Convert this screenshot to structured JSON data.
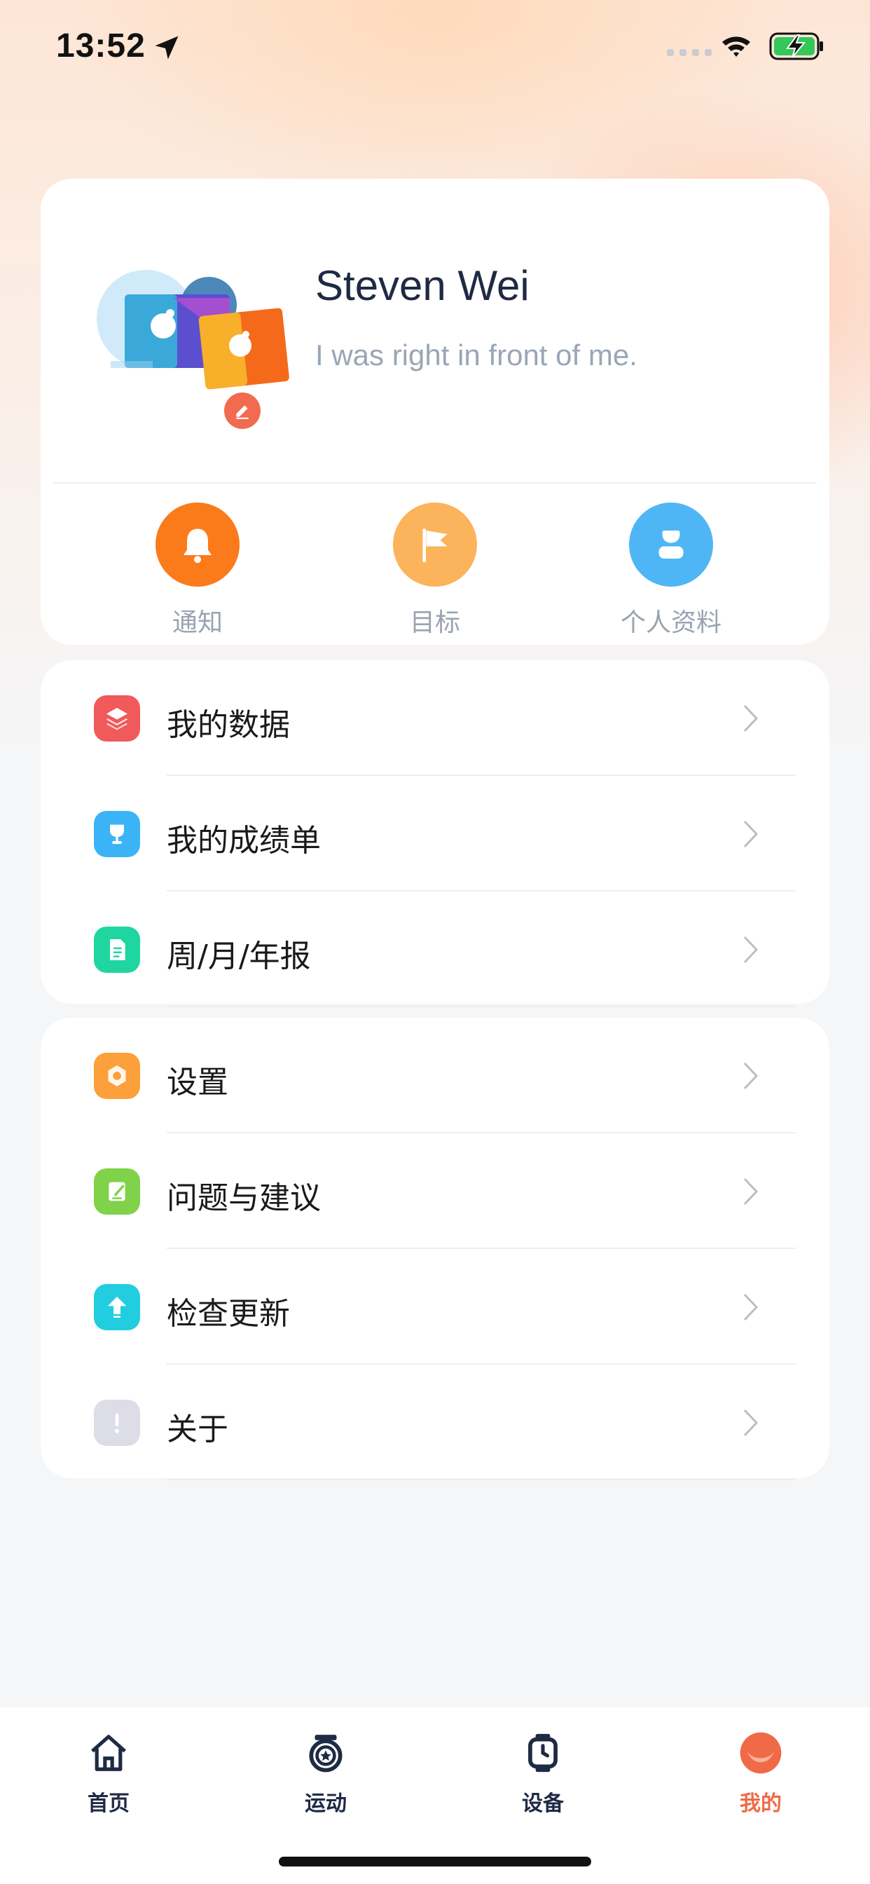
{
  "status_bar": {
    "time": "13:52"
  },
  "profile": {
    "name": "Steven Wei",
    "bio": "I was right in front of me."
  },
  "quick_actions": [
    {
      "label": "通知",
      "icon": "bell-icon",
      "color": "#fb7a1a"
    },
    {
      "label": "目标",
      "icon": "flag-icon",
      "color": "#fbb45c"
    },
    {
      "label": "个人资料",
      "icon": "user-icon",
      "color": "#4fb6f5"
    }
  ],
  "menu_group_1": [
    {
      "label": "我的数据",
      "icon": "layers-icon",
      "color": "#f05a5a"
    },
    {
      "label": "我的成绩单",
      "icon": "trophy-icon",
      "color": "#3ab4f7"
    },
    {
      "label": "周/月/年报",
      "icon": "document-icon",
      "color": "#20d6a0"
    }
  ],
  "menu_group_2": [
    {
      "label": "设置",
      "icon": "gear-icon",
      "color": "#fba03a"
    },
    {
      "label": "问题与建议",
      "icon": "feedback-icon",
      "color": "#7fd24a"
    },
    {
      "label": "检查更新",
      "icon": "upload-icon",
      "color": "#22cde0"
    },
    {
      "label": "关于",
      "icon": "info-icon",
      "color": "#dcdde6"
    }
  ],
  "tabbar": {
    "items": [
      {
        "label": "首页",
        "icon": "home-icon"
      },
      {
        "label": "运动",
        "icon": "sport-icon"
      },
      {
        "label": "设备",
        "icon": "watch-icon"
      },
      {
        "label": "我的",
        "icon": "profile-tab-icon"
      }
    ],
    "active_index": 3,
    "active_color": "#f06a48"
  }
}
